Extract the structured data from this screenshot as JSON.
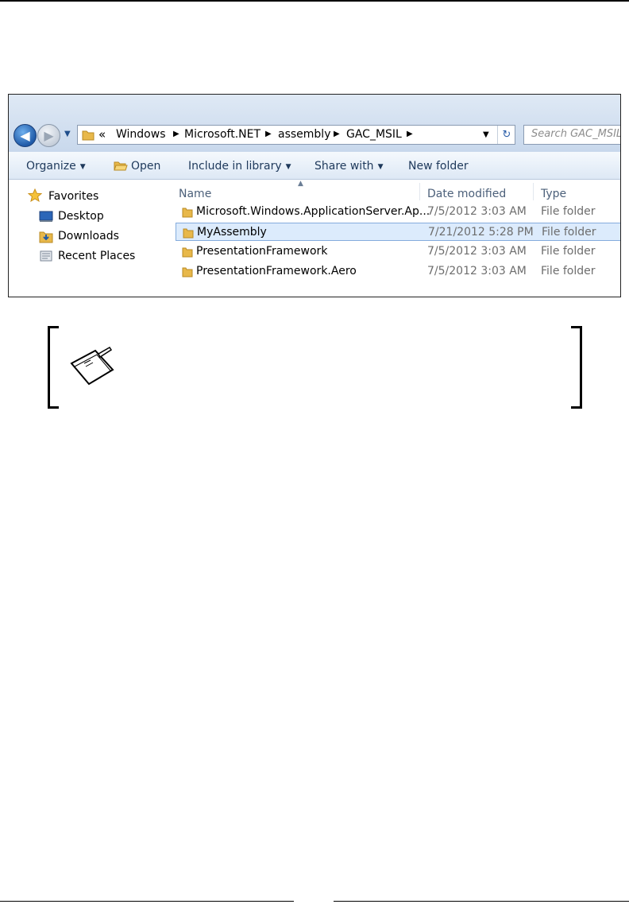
{
  "window": {
    "breadcrumb": {
      "overflow": "«",
      "items": [
        "Windows",
        "Microsoft.NET",
        "assembly",
        "GAC_MSIL"
      ]
    },
    "search_placeholder": "Search GAC_MSIL",
    "toolbar": {
      "organize": "Organize",
      "open": "Open",
      "include": "Include in library",
      "share": "Share with",
      "new_folder": "New folder"
    },
    "nav": {
      "favorites": "Favorites",
      "desktop": "Desktop",
      "downloads": "Downloads",
      "recent": "Recent Places"
    },
    "columns": {
      "name": "Name",
      "date": "Date modified",
      "type": "Type"
    },
    "files": [
      {
        "name": "Microsoft.Windows.ApplicationServer.Ap...",
        "date": "7/5/2012 3:03 AM",
        "type": "File folder"
      },
      {
        "name": "MyAssembly",
        "date": "7/21/2012 5:28 PM",
        "type": "File folder"
      },
      {
        "name": "PresentationFramework",
        "date": "7/5/2012 3:03 AM",
        "type": "File folder"
      },
      {
        "name": "PresentationFramework.Aero",
        "date": "7/5/2012 3:03 AM",
        "type": "File folder"
      }
    ]
  },
  "icons": {
    "back": "back-arrow-icon",
    "forward": "forward-arrow-icon",
    "folder": "folder-icon",
    "star": "star-icon",
    "note": "notes-icon"
  }
}
